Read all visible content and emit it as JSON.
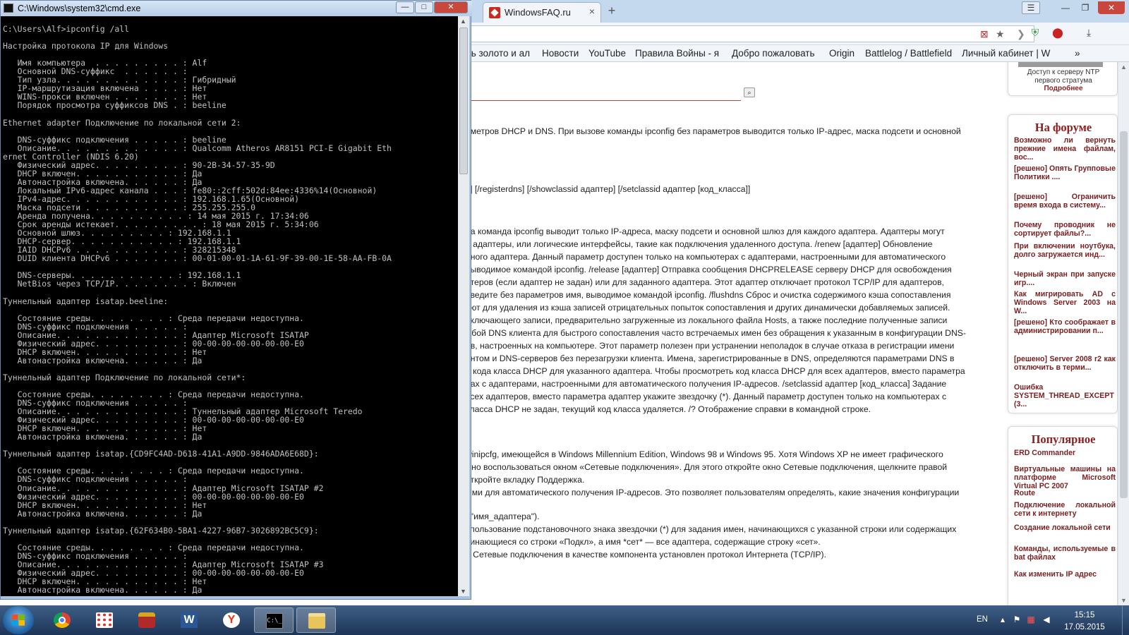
{
  "cmd": {
    "title": "C:\\Windows\\system32\\cmd.exe",
    "controls": {
      "minimize": "—",
      "maximize": "□",
      "close": "✕"
    },
    "output": [
      "C:\\Users\\Alf>ipconfig /all",
      "",
      "Настройка протокола IP для Windows",
      "",
      "   Имя компьютера  . . . . . . . . . : Alf",
      "   Основной DNS-суффикс  . . . . . . :",
      "   Тип узла. . . . . . . . . . . . . : Гибридный",
      "   IP-маршрутизация включена . . . . : Нет",
      "   WINS-прокси включен . . . . . . . : Нет",
      "   Порядок просмотра суффиксов DNS . : beeline",
      "",
      "Ethernet adapter Подключение по локальной сети 2:",
      "",
      "   DNS-суффикс подключения . . . . . : beeline",
      "   Описание. . . . . . . . . . . . . : Qualcomm Atheros AR8151 PCI-E Gigabit Eth",
      "ernet Controller (NDIS 6.20)",
      "   Физический адрес. . . . . . . . . : 90-2B-34-57-35-9D",
      "   DHCP включен. . . . . . . . . . . : Да",
      "   Автонастройка включена. . . . . . : Да",
      "   Локальный IPv6-адрес канала . . . : fe80::2cff:502d:84ee:4336%14(Основной)",
      "   IPv4-адрес. . . . . . . . . . . . : 192.168.1.65(Основной)",
      "   Маска подсети . . . . . . . . . . : 255.255.255.0",
      "   Аренда получена. . . . . . . . . . : 14 мая 2015 г. 17:34:06",
      "   Срок аренды истекает. . . . . . . . . : 18 мая 2015 г. 5:34:06",
      "   Основной шлюз. . . . . . . . . : 192.168.1.1",
      "   DHCP-сервер. . . . . . . . . . . : 192.168.1.1",
      "   IAID DHCPv6 . . . . . . . . . . . : 328215348",
      "   DUID клиента DHCPv6 . . . . . . . : 00-01-00-01-1A-61-9F-39-00-1E-58-AA-FB-0A",
      "",
      "   DNS-серверы. . . . . . . . . . . : 192.168.1.1",
      "   NetBios через TCP/IP. . . . . . . . : Включен",
      "",
      "Туннельный адаптер isatap.beeline:",
      "",
      "   Состояние среды. . . . . . . . : Среда передачи недоступна.",
      "   DNS-суффикс подключения . . . . . :",
      "   Описание. . . . . . . . . . . . . : Адаптер Microsoft ISATAP",
      "   Физический адрес. . . . . . . . . : 00-00-00-00-00-00-00-E0",
      "   DHCP включен. . . . . . . . . . . : Нет",
      "   Автонастройка включена. . . . . . : Да",
      "",
      "Туннельный адаптер Подключение по локальной сети*:",
      "",
      "   Состояние среды. . . . . . . . : Среда передачи недоступна.",
      "   DNS-суффикс подключения . . . . . :",
      "   Описание. . . . . . . . . . . . . : Туннельный адаптер Microsoft Teredo",
      "   Физический адрес. . . . . . . . . : 00-00-00-00-00-00-00-E0",
      "   DHCP включен. . . . . . . . . . . : Нет",
      "   Автонастройка включена. . . . . . : Да",
      "",
      "Туннельный адаптер isatap.{CD9FC4AD-D618-41A1-A9DD-9846ADA6E68D}:",
      "",
      "   Состояние среды. . . . . . . . : Среда передачи недоступна.",
      "   DNS-суффикс подключения . . . . . :",
      "   Описание. . . . . . . . . . . . . : Адаптер Microsoft ISATAP #2",
      "   Физический адрес. . . . . . . . . : 00-00-00-00-00-00-00-E0",
      "   DHCP включен. . . . . . . . . . . : Нет",
      "   Автонастройка включена. . . . . . : Да",
      "",
      "Туннельный адаптер isatap.{62F634B0-5BA1-4227-96B7-3026892BC5C9}:",
      "",
      "   Состояние среды. . . . . . . . : Среда передачи недоступна.",
      "   DNS-суффикс подключения . . . . . :",
      "   Описание. . . . . . . . . . . . . : Адаптер Microsoft ISATAP #3",
      "   Физический адрес. . . . . . . . . : 00-00-00-00-00-00-00-E0",
      "   DHCP включен. . . . . . . . . . . : Нет",
      "   Автонастройка включена. . . . . . : Да"
    ]
  },
  "browser": {
    "tab_title": "WindowsFAQ.ru",
    "bookmarks": [
      "ить золото и ал",
      "Новости",
      "YouTube",
      "Правила Войны - я",
      "Добро пожаловать",
      "Origin",
      "Battlelog / Battlefield",
      "Личный кабинет | W",
      "»"
    ],
    "main_lines": [
      "аметров DHCP и DNS. При вызове команды ipconfig без параметров выводится только IP-адрес, маска подсети и основной",
      "s] [/registerdns] [/showclassid адаптер] [/setclassid адаптер [код_класса]]",
      "ра команда ipconfig выводит только IP-адреса, маску подсети и основной шлюз для каждого адаптера. Адаптеры могут",
      "е адаптеры, или логические интерфейсы, такие как подключения удаленного доступа. /renew [адаптер] Обновление",
      "нного адаптера. Данный параметр доступен только на компьютерах с адаптерами, настроенными для автоматического",
      "выводимое командой ipconfig. /release [адаптер] Отправка сообщения DHCPRELEASE серверу DHCP для освобождения",
      "птеров (если адаптер не задан) или для заданного адаптера. Этот адаптер отключает протокол TCP/IP для адаптеров,",
      "введите без параметров имя, выводимое командой ipconfig. /flushdns Сброс и очистка содержимого кэша сопоставления",
      "уют для удаления из кэша записей отрицательных попыток сопоставления и других динамически добавляемых записей.",
      "включающего записи, предварительно загруженные из локального файла Hosts, а также последние полученные записи",
      "жбой DNS клиента для быстрого сопоставления часто встречаемых имен без обращения к указанным в конфигурации DNS-",
      "ов, настроенных на компьютере. Этот параметр полезен при устранении неполадок в случае отказа в регистрации имени",
      "ентом и DNS-серверов без перезагрузки клиента. Имена, зарегистрированные в DNS, определяются параметрами DNS в",
      "е кода класса DHCP для указанного адаптера. Чтобы просмотреть код класса DHCP для всех адаптеров, вместо параметра",
      "рах с адаптерами, настроенными для автоматического получения IP-адресов. /setclassid адаптер [код_класса] Задание",
      "всех адаптеров, вместо параметра адаптер укажите звездочку (*). Данный параметр доступен только на компьютерах с",
      "класса DHCP не задан, текущий код класса удаляется. /? Отображение справки в командной строке.",
      "winipcfg, имеющейся в Windows Millennium Edition, Windows 98 и Windows 95. Хотя Windows XP не имеет графического",
      "жно воспользоваться окном «Сетевые подключения». Для этого откройте окно Сетевые подключения, щелкните правой",
      "откройте вкладку Поддержка.",
      "ыми для автоматического получения IP-адресов. Это позволяет пользователям определять, какие значения конфигурации",
      ". \"имя_адаптера\").",
      "спользование подстановочного знака звездочки (*) для задания имен, начинающихся с указанной строки или содержащих",
      "чинающиеся со строки «Подкл», а имя *сет* — все адаптера, содержащие строку «сет».",
      "е Сетевые подключения в качестве компонента установлен протокол Интернета (TCP/IP)."
    ],
    "ntp_box": {
      "line1": "Доступ к серверу NTP",
      "line2": "первого стратума",
      "link": "Подробнее"
    },
    "forum": {
      "title": "На форуме",
      "items": [
        "Возможно ли вернуть прежние имена файлам, вос...",
        "[решено] Опять Групповые Политики ....",
        "[решено] Ограничить время входа в систему...",
        "Почему проводник не сортирует файлы?...",
        "При включении ноутбука, долго загружается инд...",
        "Черный экран при запуске игр....",
        "Как мигрировать AD с Windows Server 2003 на W...",
        "[решено] Кто соображает в администрировании п...",
        "[решено] Server 2008 r2 как отключить в терми...",
        "Ошибка SYSTEM_THREAD_EXCEPT (3..."
      ]
    },
    "popular": {
      "title": "Популярное",
      "items": [
        "ERD Commander",
        "Виртуальные машины на платформе Microsoft Virtual PC 2007",
        "Route",
        "Подключение локальной сети к интернету",
        "Создание локальной сети",
        "Команды, используемые в bat файлах",
        "Как изменить IP адрес"
      ]
    }
  },
  "taskbar": {
    "apps": [
      "start",
      "chrome",
      "apps-grid",
      "lock-app",
      "word",
      "yandex-browser",
      "cmd",
      "explorer"
    ],
    "lang": "EN",
    "time": "15:15",
    "date": "17.05.2015"
  },
  "colors": {
    "accent_red": "#8b1e1e",
    "console_bg": "#000000",
    "console_fg": "#c0c0c0",
    "taskbar": "#1d3557"
  }
}
